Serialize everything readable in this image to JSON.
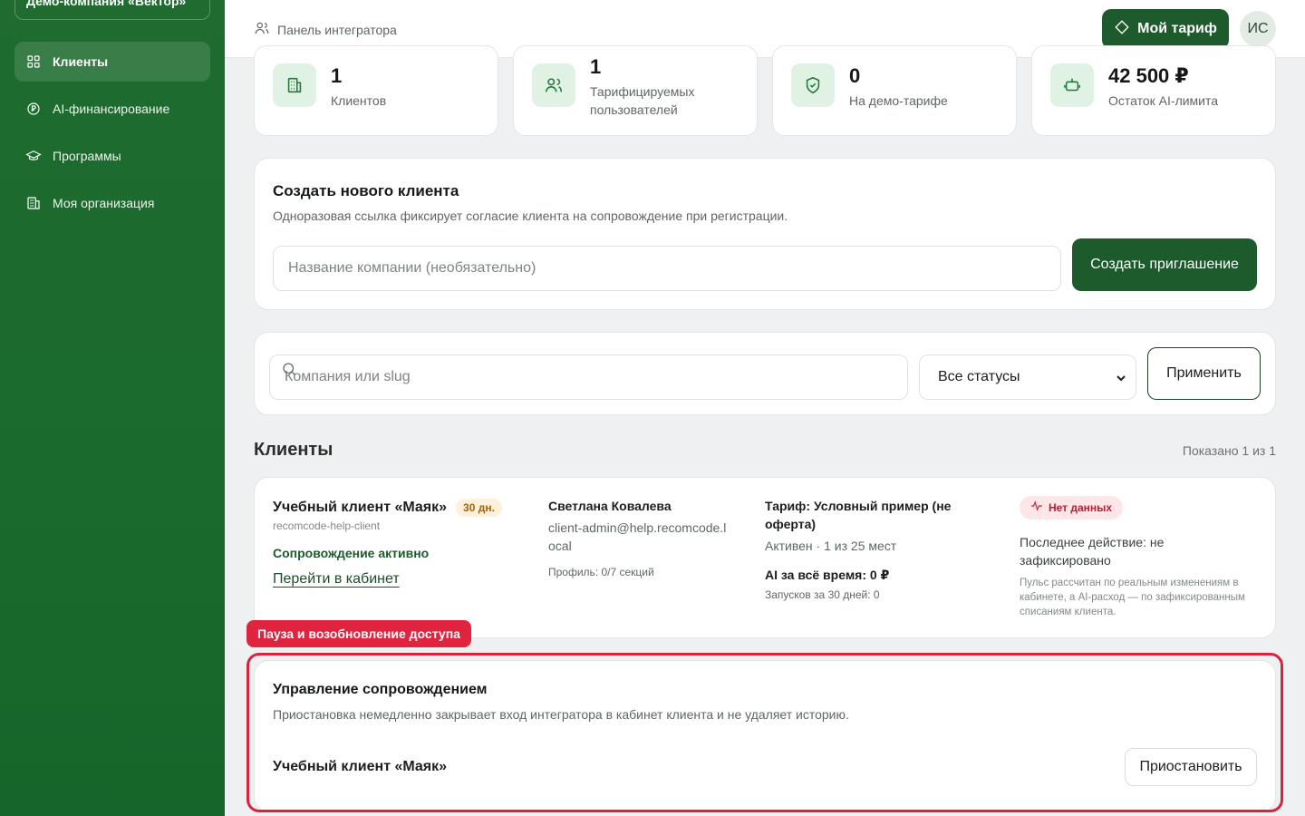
{
  "sidebar": {
    "org_name": "Демо-компания «Вектор»",
    "items": [
      {
        "label": "Клиенты",
        "icon": "grid-icon",
        "active": true
      },
      {
        "label": "AI-финансирование",
        "icon": "coin-icon"
      },
      {
        "label": "Программы",
        "icon": "graduation-cap-icon"
      },
      {
        "label": "Моя организация",
        "icon": "building-icon"
      }
    ]
  },
  "header": {
    "breadcrumb": "Панель интегратора",
    "tariff_button": "Мой тариф",
    "avatar_initials": "ИС"
  },
  "stats": [
    {
      "value": "1",
      "label": "Клиентов",
      "icon": "building-icon"
    },
    {
      "value": "1",
      "label": "Тарифицируемых пользователей",
      "icon": "users-icon"
    },
    {
      "value": "0",
      "label": "На демо-тарифе",
      "icon": "shield-check-icon"
    },
    {
      "value": "42 500 ₽",
      "label": "Остаток AI-лимита",
      "icon": "robot-icon"
    }
  ],
  "create_client": {
    "title": "Создать нового клиента",
    "description": "Одноразовая ссылка фиксирует согласие клиента на сопровождение при регистрации.",
    "input_placeholder": "Название компании (необязательно)",
    "button": "Создать приглашение"
  },
  "filter": {
    "search_placeholder": "Компания или slug",
    "status_selected": "Все статусы",
    "apply_button": "Применить"
  },
  "clients_section": {
    "title": "Клиенты",
    "count_text": "Показано 1 из 1"
  },
  "client_card": {
    "name": "Учебный клиент «Маяк»",
    "days_badge": "30 дн.",
    "slug": "recomcode-help-client",
    "support_status": "Сопровождение активно",
    "open_link": "Перейти в кабинет",
    "contact_name": "Светлана Ковалева",
    "contact_email": "client-admin@help.recomcode.local",
    "profile_text": "Профиль: 0/7 секций",
    "tariff_title": "Тариф: Условный пример (не оферта)",
    "tariff_status": "Активен",
    "tariff_seats": "1 из 25 мест",
    "ai_total": "AI за всё время: 0 ₽",
    "runs_30d": "Запусков за 30 дней: 0",
    "pulse_badge": "Нет данных",
    "last_action": "Последнее действие: не зафиксировано",
    "pulse_note": "Пульс рассчитан по реальным изменениям в кабинете, а AI-расход — по зафиксированным списаниям клиента."
  },
  "support_management": {
    "tag": "Пауза и возобновление доступа",
    "title": "Управление сопровождением",
    "description": "Приостановка немедленно закрывает вход интегратора в кабинет клиента и не удаляет историю.",
    "client_name": "Учебный клиент «Маяк»",
    "pause_button": "Приостановить"
  },
  "colors": {
    "sidebar_bg": "#1f6b30",
    "primary": "#1d5a2c",
    "icon_bg": "#dff2e4",
    "highlight": "#d7233e",
    "badge_days_bg": "#fdf1dc",
    "badge_pulse_bg": "#fde6e8"
  }
}
